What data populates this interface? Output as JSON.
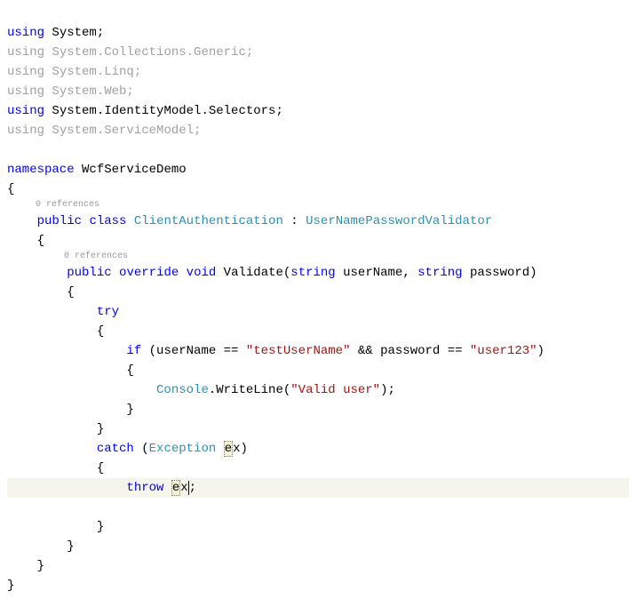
{
  "lines": {
    "l1_using": "using",
    "l1_ns": "System",
    "l1_end": ";",
    "l2_using": "using",
    "l2_rest": " System.Collections.Generic;",
    "l3_using": "using",
    "l3_rest": " System.Linq;",
    "l4_using": "using",
    "l4_rest": " System.Web;",
    "l5_using": "using",
    "l5_ns": " System.IdentityModel.Selectors;",
    "l6_using": "using",
    "l6_rest": " System.ServiceModel;",
    "l8_namespace": "namespace",
    "l8_name": " WcfServiceDemo",
    "l9_brace": "{",
    "ref1": "0 references",
    "l10_indent": "    ",
    "l10_public": "public",
    "l10_sp1": " ",
    "l10_class": "class",
    "l10_sp2": " ",
    "l10_classname": "ClientAuthentication",
    "l10_sp3": " : ",
    "l10_base": "UserNamePasswordValidator",
    "l11_open": "    {",
    "ref2": "0 references",
    "l12_indent": "        ",
    "l12_public": "public",
    "l12_sp1": " ",
    "l12_override": "override",
    "l12_sp2": " ",
    "l12_void": "void",
    "l12_sp3": " Validate(",
    "l12_string1": "string",
    "l12_sp4": " userName, ",
    "l12_string2": "string",
    "l12_sp5": " password)",
    "l13_open": "        {",
    "l14_indent": "            ",
    "l14_try": "try",
    "l15_open": "            {",
    "l16_indent": "                ",
    "l16_if": "if",
    "l16_open": " (userName == ",
    "l16_str1": "\"testUserName\"",
    "l16_mid": " && password == ",
    "l16_str2": "\"user123\"",
    "l16_close": ")",
    "l17_open": "                {",
    "l18_indent": "                    ",
    "l18_console": "Console",
    "l18_writeline": ".WriteLine(",
    "l18_str": "\"Valid user\"",
    "l18_close": ");",
    "l19_close": "                }",
    "l20_close": "            }",
    "l21_indent": "            ",
    "l21_catch": "catch",
    "l21_open": " (",
    "l21_exc": "Exception",
    "l21_sp": " ",
    "l21_ex_e": "e",
    "l21_ex_x": "x",
    "l21_close": ")",
    "l22_open": "            {",
    "l23_indent": "                ",
    "l23_throw": "throw",
    "l23_sp": " ",
    "l23_ex_e": "e",
    "l23_ex_x": "x",
    "l23_semi": ";",
    "l24_close": "            }",
    "l25_close": "        }",
    "l26_close": "    }",
    "l27_close": "}"
  }
}
